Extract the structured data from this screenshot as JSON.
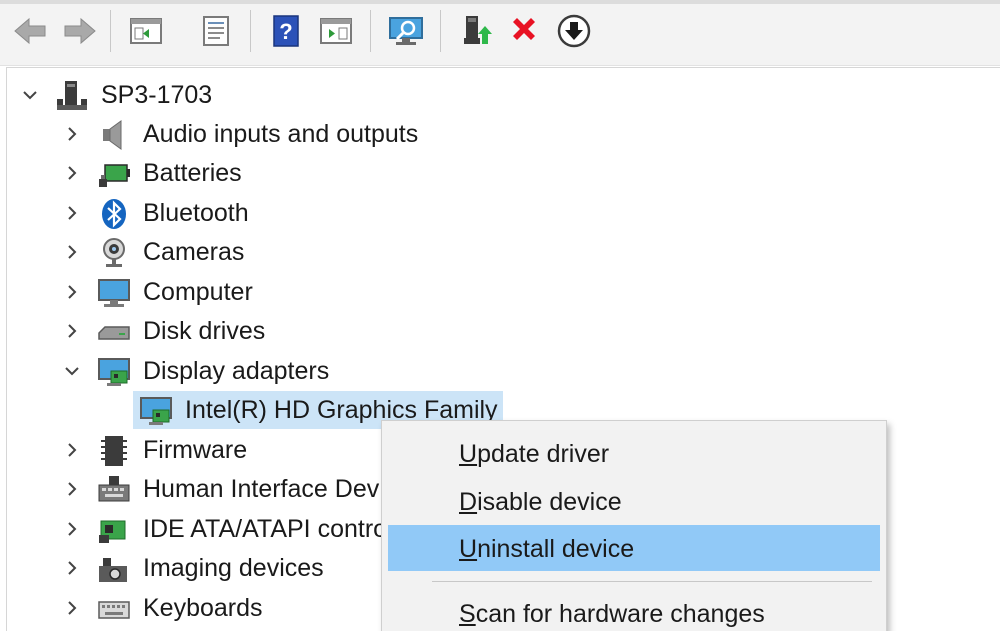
{
  "colors": {
    "toolbar_bg": "#f3f3f3",
    "selection_bg": "#cce4f7",
    "menu_highlight": "#91c9f7",
    "delete_red": "#e81123"
  },
  "toolbar": {
    "buttons": [
      "back-icon",
      "forward-icon",
      "show-hide-console-tree-icon",
      "properties-icon",
      "help-icon",
      "action-pane-icon",
      "scan-hardware-icon",
      "update-driver-icon",
      "uninstall-icon",
      "disable-device-icon"
    ]
  },
  "tree": {
    "root": "SP3-1703",
    "categories": {
      "audio": "Audio inputs and outputs",
      "batteries": "Batteries",
      "bluetooth": "Bluetooth",
      "cameras": "Cameras",
      "computer": "Computer",
      "disk": "Disk drives",
      "display": "Display adapters",
      "display_child": "Intel(R) HD Graphics Family",
      "firmware": "Firmware",
      "hid": "Human Interface Dev",
      "ide": "IDE ATA/ATAPI control",
      "imaging": "Imaging devices",
      "keyboards": "Keyboards"
    }
  },
  "context_menu": {
    "update": {
      "u": "U",
      "rest": "pdate driver"
    },
    "disable": {
      "u": "D",
      "rest": "isable device"
    },
    "uninstall": {
      "u": "U",
      "rest": "ninstall device"
    },
    "scan": {
      "u": "S",
      "rest": "can for hardware changes"
    }
  }
}
